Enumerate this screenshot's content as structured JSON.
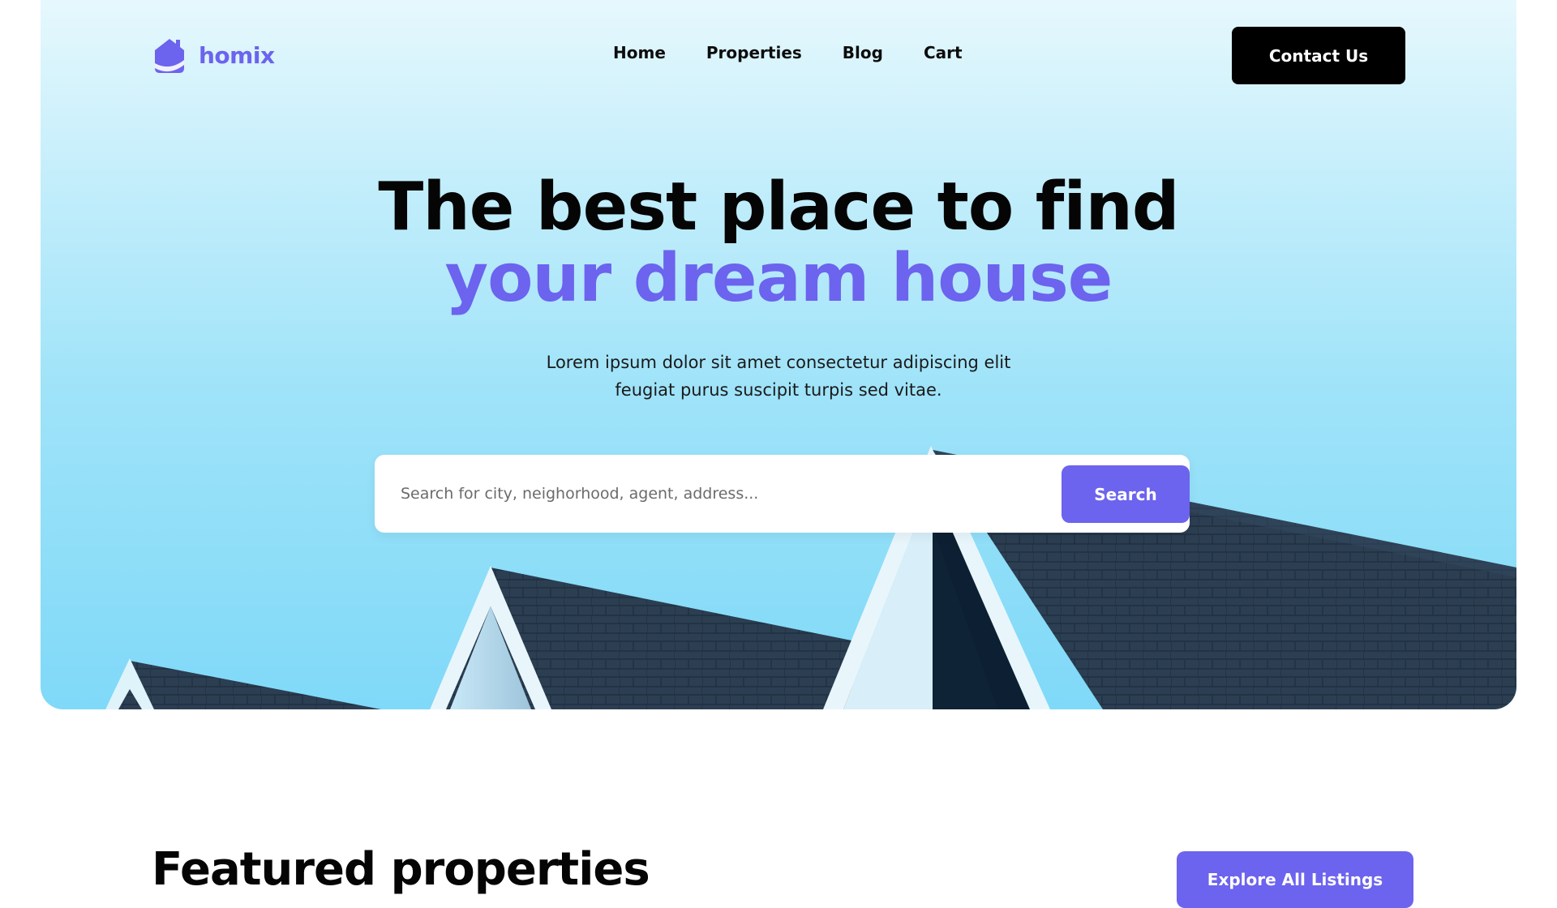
{
  "brand": {
    "name": "homix",
    "logo_icon": "house-icon",
    "accent_color": "#6c63ee"
  },
  "nav": {
    "items": [
      "Home",
      "Properties",
      "Blog",
      "Cart"
    ],
    "contact_label": "Contact Us"
  },
  "hero": {
    "headline_line1": "The best place to find",
    "headline_line2": "your dream house",
    "subtext_line1": "Lorem ipsum dolor sit amet consectetur adipiscing elit",
    "subtext_line2": "feugiat purus suscipit turpis sed vitae.",
    "background_image": "house-roofs-photo"
  },
  "search": {
    "placeholder": "Search for city, neighorhood, agent, address...",
    "value": "",
    "button_label": "Search"
  },
  "featured": {
    "title": "Featured properties",
    "explore_label": "Explore All Listings"
  }
}
